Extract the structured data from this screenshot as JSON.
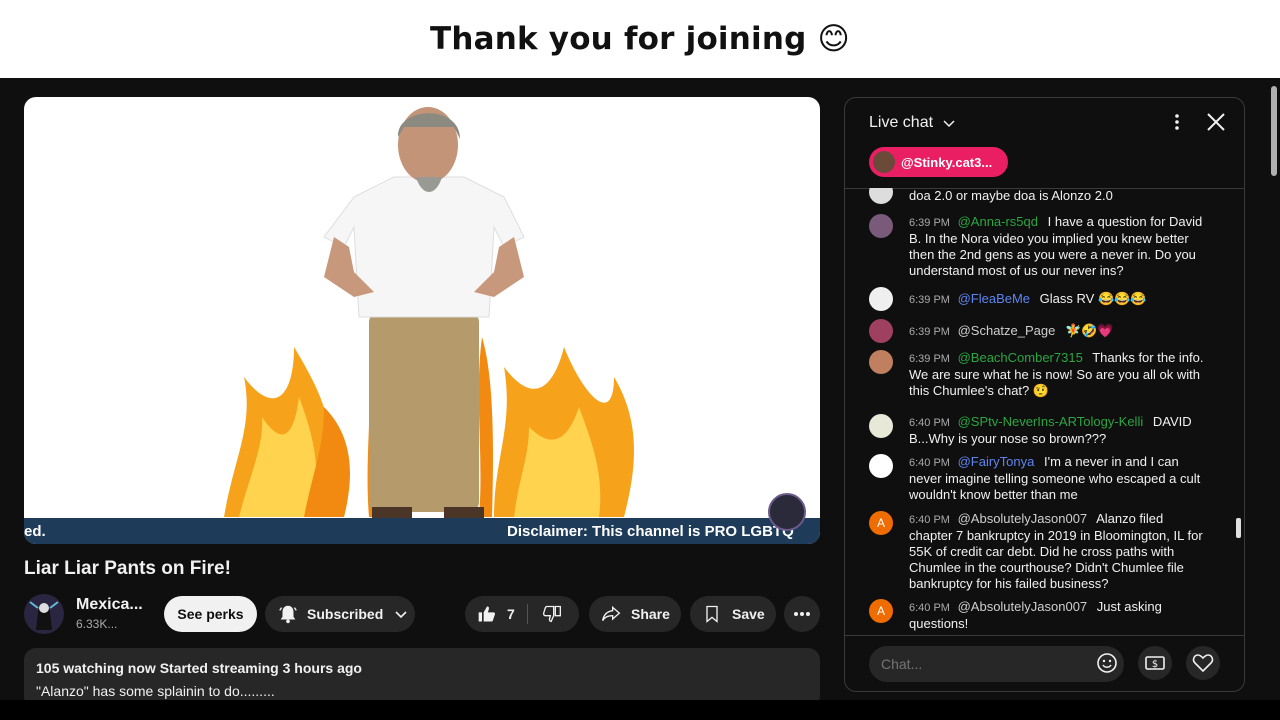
{
  "banner": {
    "title": "Thank you for joining 😊"
  },
  "video": {
    "ticker_left": "ed.",
    "ticker_right": "Disclaimer: This channel is PRO LGBTQ"
  },
  "title": "Liar Liar Pants on Fire!",
  "channel": {
    "name": "Mexica...",
    "subs": "6.33K..."
  },
  "actions": {
    "perks": "See perks",
    "subscribed": "Subscribed",
    "likes": "7",
    "share": "Share",
    "save": "Save"
  },
  "description": {
    "stats": "105 watching now  Started streaming 3 hours ago",
    "text": "\"Alanzo\" has some splainin to do........."
  },
  "chat": {
    "title": "Live chat",
    "pinned_user": "@Stinky.cat3...",
    "input_placeholder": "Chat...",
    "messages": [
      {
        "time": "",
        "author": "",
        "text": "doa 2.0 or maybe doa is Alonzo 2.0",
        "author_color": "#f1f1f1",
        "avatar": "#dddddd"
      },
      {
        "time": "6:39 PM",
        "author": "@Anna-rs5qd",
        "text": "I have a question for David B. In the Nora video you implied you knew better then the 2nd gens as you were a never in. Do you understand most of us our never ins?",
        "author_color": "#2ba640",
        "avatar": "#7a5a7a"
      },
      {
        "time": "6:39 PM",
        "author": "@FleaBeMe",
        "text": "Glass RV 😂😂😂",
        "author_color": "#5e84f1",
        "avatar": "#efefef"
      },
      {
        "time": "6:39 PM",
        "author": "@Schatze_Page",
        "text": "🧚🤣💗",
        "author_color": "#cfcfcf",
        "avatar": "#a04060"
      },
      {
        "time": "6:39 PM",
        "author": "@BeachComber7315",
        "text": "Thanks for the info. We are sure what he is now! So are you all ok with this Chumlee's chat? 🤨",
        "author_color": "#2ba640",
        "avatar": "#c08060"
      },
      {
        "time": "6:40 PM",
        "author": "@SPtv-NeverIns-ARTology-Kelli",
        "text": "DAVID B...Why is your nose so brown???",
        "author_color": "#2ba640",
        "avatar": "#e8e8d8"
      },
      {
        "time": "6:40 PM",
        "author": "@FairyTonya",
        "text": "I'm a never in and I can never imagine telling someone who escaped a cult wouldn't know better than me",
        "author_color": "#5e84f1",
        "avatar": "#ffffff"
      },
      {
        "time": "6:40 PM",
        "author": "@AbsolutelyJason007",
        "text": "Alanzo filed chapter 7 bankruptcy in 2019 in Bloomington, IL for 55K of credit car debt. Did he cross paths with Chumlee in the courthouse? Didn't Chumlee file bankruptcy for his failed business?",
        "author_color": "#cfcfcf",
        "avatar": "#ef6c00",
        "initial": "A"
      },
      {
        "time": "6:40 PM",
        "author": "@AbsolutelyJason007",
        "text": "Just asking questions!",
        "author_color": "#cfcfcf",
        "avatar": "#ef6c00",
        "initial": "A"
      }
    ]
  }
}
